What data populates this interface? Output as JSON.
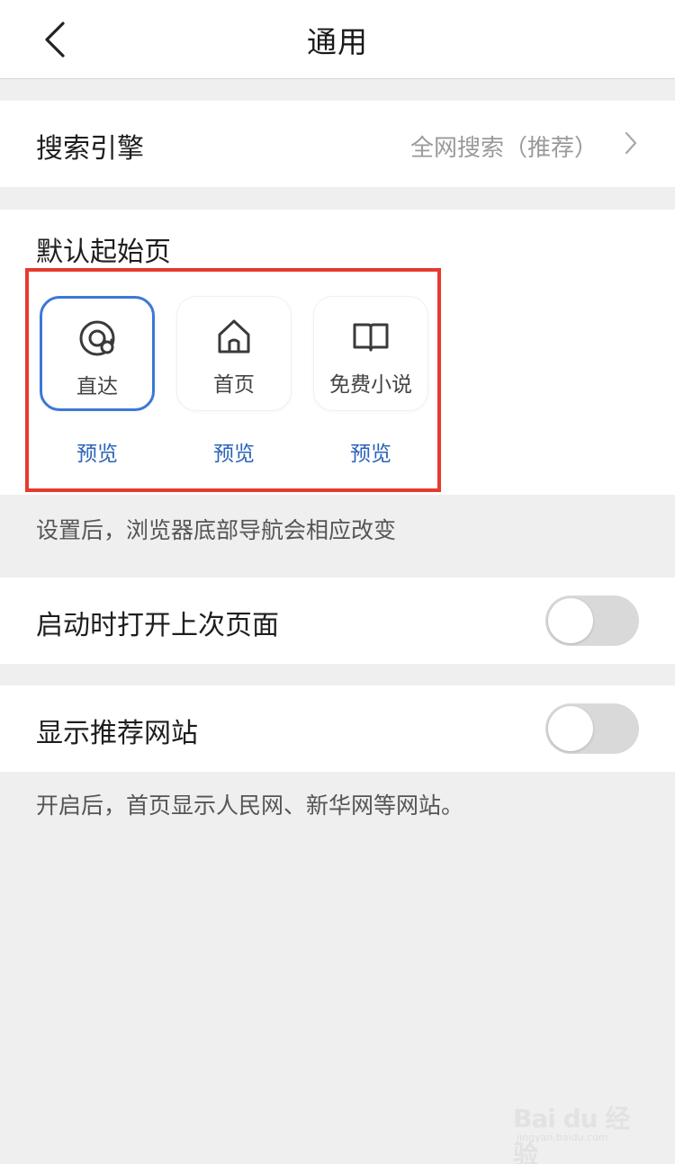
{
  "header": {
    "title": "通用",
    "back_icon": "chevron-left-icon"
  },
  "search_engine": {
    "label": "搜索引擎",
    "value": "全网搜索（推荐）"
  },
  "start_page": {
    "label": "默认起始页",
    "options": [
      {
        "label": "直达",
        "icon": "at-sign-icon",
        "selected": true,
        "preview": "预览"
      },
      {
        "label": "首页",
        "icon": "home-icon",
        "selected": false,
        "preview": "预览"
      },
      {
        "label": "免费小说",
        "icon": "book-icon",
        "selected": false,
        "preview": "预览"
      }
    ],
    "hint": "设置后，浏览器底部导航会相应改变",
    "highlight_color": "#e53a2f",
    "selected_color": "#3b78d8"
  },
  "launch_restore": {
    "label": "启动时打开上次页面",
    "enabled": false
  },
  "recommend_sites": {
    "label": "显示推荐网站",
    "enabled": false,
    "hint": "开启后，首页显示人民网、新华网等网站。"
  },
  "watermark": {
    "text": "Bai du 经验",
    "sub": "jingyan.baidu.com"
  }
}
